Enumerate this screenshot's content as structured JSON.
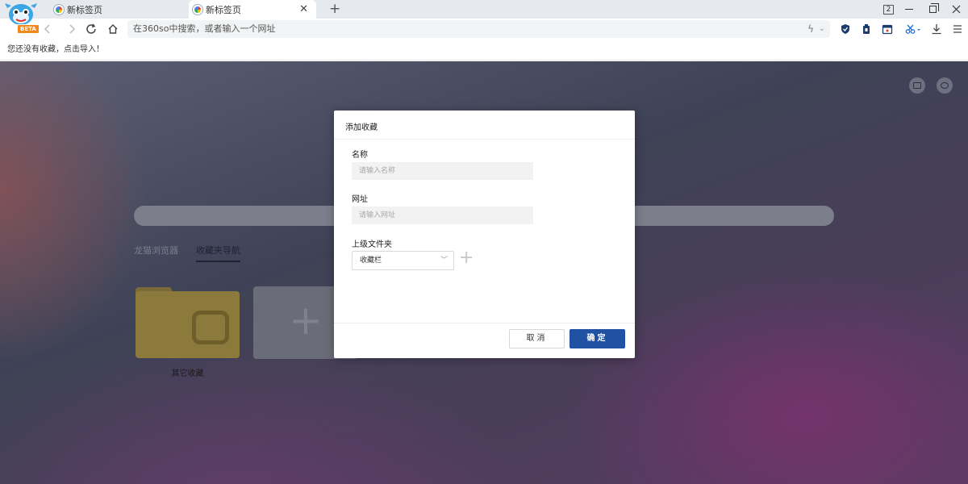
{
  "browser": {
    "logo_badge": "BETA",
    "tabs": [
      {
        "title": "新标签页",
        "active": false
      },
      {
        "title": "新标签页",
        "active": true
      }
    ],
    "tab_close_glyph": "✕",
    "new_tab_glyph": "+",
    "tab_count": "2",
    "address_placeholder": "在360so中搜索，或者输入一个网址",
    "toolbar_icons": [
      "shield-icon",
      "extension-icon",
      "calendar-icon",
      "scissors-icon",
      "download-icon",
      "menu-icon"
    ],
    "accent_color": "#2051a3"
  },
  "bookmark_bar": {
    "message": "您还没有收藏，点击导入！"
  },
  "newtab": {
    "nav_tabs": [
      {
        "label": "龙猫浏览器",
        "active": false
      },
      {
        "label": "收藏夹导航",
        "active": true
      }
    ],
    "folder_label": "其它收藏",
    "add_tile_glyph": "+"
  },
  "dialog": {
    "title": "添加收藏",
    "name_label": "名称",
    "name_placeholder": "请输入名称",
    "name_value": "",
    "url_label": "网址",
    "url_placeholder": "请输入网址",
    "url_value": "",
    "parent_folder_label": "上级文件夹",
    "parent_folder_selected": "收藏栏",
    "add_folder_glyph": "+",
    "cancel_label": "取消",
    "ok_label": "确定"
  }
}
